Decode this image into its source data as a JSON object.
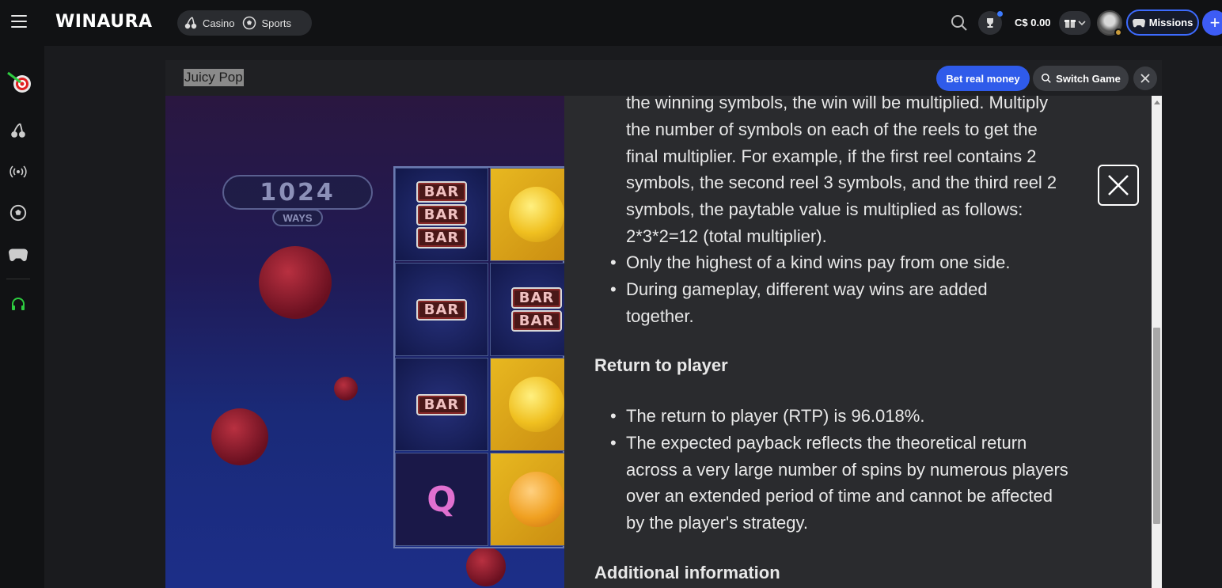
{
  "header": {
    "logo": "WINAURA",
    "nav": [
      {
        "label": "Casino",
        "icon": "cherry-icon"
      },
      {
        "label": "Sports",
        "icon": "soccer-ball-icon"
      }
    ],
    "balance": "C$ 0.00",
    "missions_label": "Missions",
    "plus_label": "+"
  },
  "sidebar": {
    "items": [
      {
        "icon": "dart-target-icon"
      },
      {
        "icon": "cherry-icon"
      },
      {
        "icon": "live-broadcast-icon"
      },
      {
        "icon": "soccer-ball-icon"
      },
      {
        "icon": "gamepad-icon"
      },
      {
        "icon": "headset-icon"
      }
    ]
  },
  "game_header": {
    "title": "Juicy Pop",
    "bet_real_money": "Bet real money",
    "switch_game": "Switch Game"
  },
  "game": {
    "ways_number": "1024",
    "ways_label": "WAYS",
    "bar_label": "BAR",
    "q_label": "Q"
  },
  "paytable": {
    "intro_lines": [
      "the winning symbols, the win will be multiplied. Multiply",
      "the number of symbols on each of the reels to get the",
      "final multiplier. For example, if the first reel contains 2",
      "symbols, the second reel 3 symbols, and the third reel 2",
      "symbols, the paytable value is multiplied as follows:",
      "2*3*2=12 (total multiplier)."
    ],
    "bullets_1": [
      "Only the highest of a kind wins pay from one side.",
      "During gameplay, different way wins are added together."
    ],
    "rtp_heading": "Return to player",
    "bullets_2": [
      "The return to player (RTP) is 96.018%.",
      "The expected payback reflects the theoretical return across a very large number of spins by numerous players over an extended period of time and cannot be affected by the player's strategy."
    ],
    "additional_heading": "Additional information"
  },
  "colors": {
    "accent_blue": "#2f5bea",
    "missions_border": "#3d6bff",
    "headset_green": "#2ecc40"
  }
}
